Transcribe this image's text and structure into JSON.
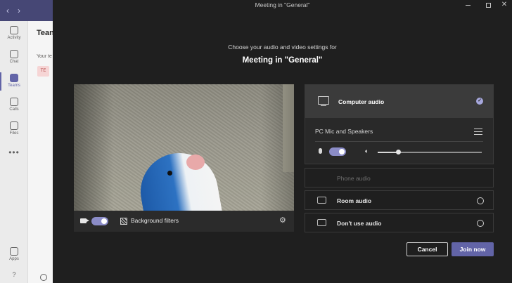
{
  "window": {
    "title": "Meeting in \"General\""
  },
  "teams_background": {
    "nav_back": "‹",
    "nav_forward": "›",
    "rail": [
      {
        "label": "Activity",
        "icon": "bell-icon"
      },
      {
        "label": "Chat",
        "icon": "chat-icon"
      },
      {
        "label": "Teams",
        "icon": "teams-icon",
        "active": true
      },
      {
        "label": "Calls",
        "icon": "phone-icon"
      },
      {
        "label": "Files",
        "icon": "file-icon"
      },
      {
        "label": "Apps",
        "icon": "apps-icon"
      }
    ],
    "more": "•••",
    "help": "?",
    "panel_title": "Tean",
    "panel_text": "Your te",
    "avatar_initials": "TE"
  },
  "prejoin": {
    "subtitle": "Choose your audio and video settings for",
    "heading": "Meeting in \"General\"",
    "video": {
      "camera_on": true,
      "background_filters_label": "Background filters"
    },
    "audio": {
      "selected_option": "Computer audio",
      "device": "PC Mic and Speakers",
      "mic_on": true,
      "speaker_volume": 0.2,
      "options": [
        {
          "label": "Phone audio",
          "disabled": true
        },
        {
          "label": "Room audio",
          "icon": "room-audio-icon"
        },
        {
          "label": "Don't use audio",
          "icon": "no-audio-icon"
        }
      ]
    },
    "buttons": {
      "cancel": "Cancel",
      "join": "Join now"
    }
  },
  "colors": {
    "accent": "#6264a7",
    "toggle": "#8b8cc7",
    "window_bg": "#1f1f1f"
  }
}
